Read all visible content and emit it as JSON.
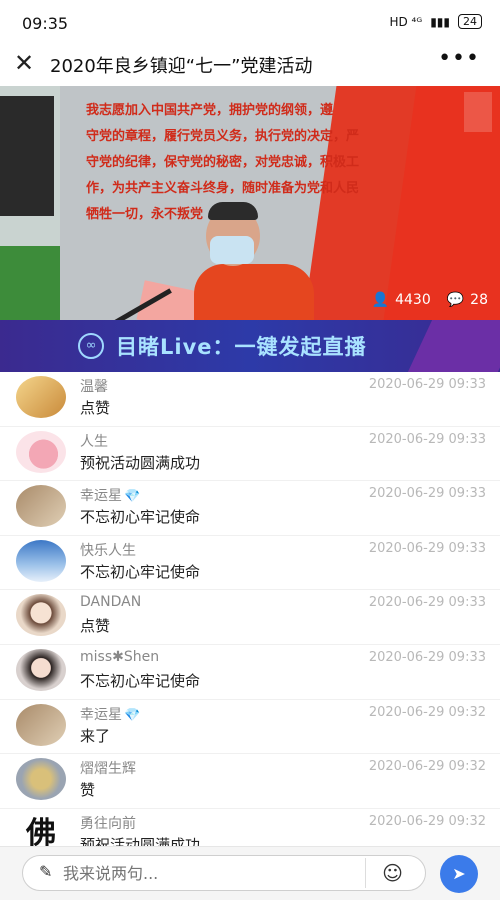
{
  "status_bar": {
    "time": "09:35",
    "network": "HD ⁴ᴳ",
    "battery": "24"
  },
  "header": {
    "title": "2020年良乡镇迎“七一”党建活动",
    "close_icon": "close-icon",
    "more_label": "•••"
  },
  "video": {
    "oath_lines": [
      "我志愿加入中国共产党，拥护党的纲领，遵",
      "守党的章程，履行党员义务，执行党的决定，严",
      "守党的纪律，保守党的秘密，对党忠诚，积极工",
      "作，为共产主义奋斗终身，随时准备为党和人民",
      "牺牲一切，永不叛党"
    ],
    "viewers": "4430",
    "comments_count": "28"
  },
  "banner": {
    "text": "目睹Live：一键发起直播"
  },
  "comments": [
    {
      "name": "温馨",
      "time": "2020-06-29 09:33",
      "text": "点赞",
      "badge": ""
    },
    {
      "name": "人生",
      "time": "2020-06-29 09:33",
      "text": "预祝活动圆满成功",
      "badge": ""
    },
    {
      "name": "幸运星",
      "time": "2020-06-29 09:33",
      "text": "不忘初心牢记使命",
      "badge": "💎"
    },
    {
      "name": "快乐人生",
      "time": "2020-06-29 09:33",
      "text": "不忘初心牢记使命",
      "badge": ""
    },
    {
      "name": "DANDAN",
      "time": "2020-06-29 09:33",
      "text": "点赞",
      "badge": ""
    },
    {
      "name": "miss✱Shen",
      "time": "2020-06-29 09:33",
      "text": "不忘初心牢记使命",
      "badge": ""
    },
    {
      "name": "幸运星",
      "time": "2020-06-29 09:32",
      "text": "来了",
      "badge": "💎"
    },
    {
      "name": "熠熠生辉",
      "time": "2020-06-29 09:32",
      "text": "赞",
      "badge": ""
    },
    {
      "name": "勇往向前",
      "time": "2020-06-29 09:32",
      "text": "预祝活动圆满成功",
      "badge": ""
    }
  ],
  "input": {
    "placeholder": "我来说两句..."
  },
  "colors": {
    "accent": "#3b7bea",
    "banner_text": "#a9e2ff",
    "timestamp": "#b8b8b8"
  }
}
